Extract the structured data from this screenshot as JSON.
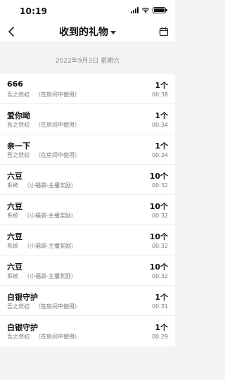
{
  "status_bar": {
    "time": "10:19"
  },
  "nav": {
    "title": "收到的礼物"
  },
  "date_header": "2022年9月3日  星期六",
  "gifts": [
    {
      "name": "666",
      "sender": "吾之然初",
      "note": "（在房间中使用）",
      "count": "1个",
      "time": "00:38"
    },
    {
      "name": "爱你呦",
      "sender": "吾之然初",
      "note": "（在房间中使用）",
      "count": "1个",
      "time": "00:34"
    },
    {
      "name": "亲一下",
      "sender": "吾之然初",
      "note": "（在房间中使用）",
      "count": "1个",
      "time": "00:34"
    },
    {
      "name": "六豆",
      "sender": "系统",
      "note": "（小福袋-主播奖励）",
      "count": "10个",
      "time": "00:32"
    },
    {
      "name": "六豆",
      "sender": "系统",
      "note": "（小福袋-主播奖励）",
      "count": "10个",
      "time": "00:32"
    },
    {
      "name": "六豆",
      "sender": "系统",
      "note": "（小福袋-主播奖励）",
      "count": "10个",
      "time": "00:32"
    },
    {
      "name": "六豆",
      "sender": "系统",
      "note": "（小福袋-主播奖励）",
      "count": "10个",
      "time": "00:32"
    },
    {
      "name": "白银守护",
      "sender": "吾之然初",
      "note": "（在房间中使用）",
      "count": "1个",
      "time": "00:31"
    },
    {
      "name": "白银守护",
      "sender": "吾之然初",
      "note": "（在房间中使用）",
      "count": "1个",
      "time": "00:29"
    }
  ],
  "icons": {
    "back": "chevron-left-icon",
    "calendar": "calendar-icon",
    "dropdown": "caret-down-icon",
    "signal": "cellular-signal-icon",
    "wifi": "wifi-icon",
    "battery": "battery-icon"
  },
  "battery_level": 1.0
}
